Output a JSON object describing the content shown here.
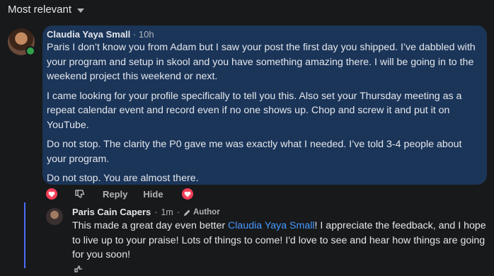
{
  "sort": {
    "label": "Most relevant"
  },
  "comment": {
    "author": "Claudia Yaya Small",
    "separator": "·",
    "time": "10h",
    "paragraphs": [
      "Paris I don’t know you from Adam but I saw your post the first day you shipped. I’ve dabbled with your program and setup in skool and you have something amazing there. I will be going in to the weekend project this weekend or next.",
      "I came looking for your profile specifically to tell you this. Also set your Thursday meeting as a repeat calendar event and record even if no one shows up. Chop and screw it and put it on YouTube.",
      "Do not stop. The clarity the P0 gave me was exactly what I needed. I’ve told 3-4 people about your program.",
      "Do not stop. You are almost there."
    ],
    "actions": {
      "reply": "Reply",
      "hide": "Hide"
    }
  },
  "reply": {
    "author": "Paris Cain Capers",
    "separator": "·",
    "time": "1m",
    "separator2": "·",
    "badge": "Author",
    "text_before": "This made a great day even better ",
    "mention": "Claudia Yaya Small",
    "text_after": "! I appreciate the feedback, and I hope to live up to your praise! Lots of things to come! I'd love to see and hear how things are going for you soon!"
  },
  "colors": {
    "background": "#18191a",
    "bubble": "#1b3559",
    "heart": "#f33e58",
    "mention": "#4599ff",
    "thread_line": "#4a6cf7",
    "online": "#31a24c"
  },
  "icons": [
    "caret-down-icon",
    "love-reaction-icon",
    "thumbs-down-icon",
    "pencil-icon"
  ]
}
